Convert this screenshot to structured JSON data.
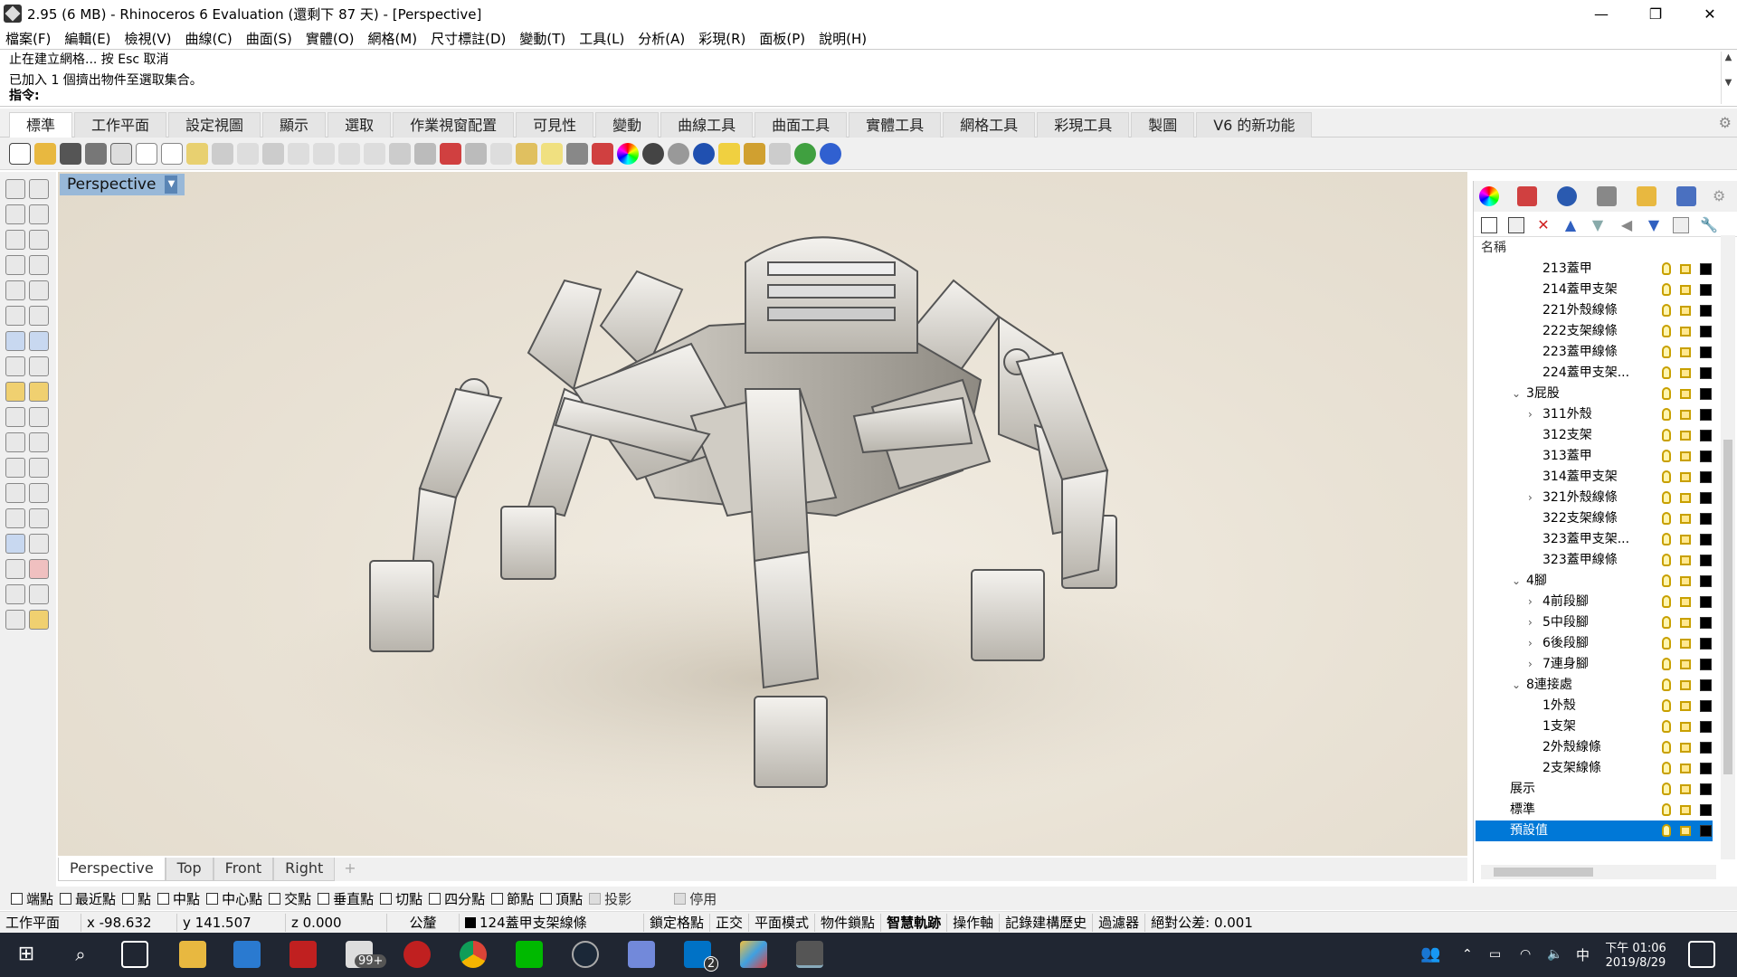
{
  "window": {
    "title": "2.95 (6 MB) - Rhinoceros 6 Evaluation (還剩下 87 天) - [Perspective]",
    "minimize": "—",
    "restore": "❐",
    "close": "✕"
  },
  "menu": [
    "檔案(F)",
    "編輯(E)",
    "檢視(V)",
    "曲線(C)",
    "曲面(S)",
    "實體(O)",
    "網格(M)",
    "尺寸標註(D)",
    "變動(T)",
    "工具(L)",
    "分析(A)",
    "彩現(R)",
    "面板(P)",
    "說明(H)"
  ],
  "command": {
    "history": [
      "止在建立網格... 按 Esc 取消",
      "已加入 1 個擠出物件至選取集合。"
    ],
    "prompt": "指令:"
  },
  "ribbon_tabs": [
    "標準",
    "工作平面",
    "設定視圖",
    "顯示",
    "選取",
    "作業視窗配置",
    "可見性",
    "變動",
    "曲線工具",
    "曲面工具",
    "實體工具",
    "網格工具",
    "彩現工具",
    "製圖",
    "V6 的新功能"
  ],
  "viewport": {
    "title": "Perspective",
    "tabs": [
      "Perspective",
      "Top",
      "Front",
      "Right"
    ],
    "add_tab": "+"
  },
  "layers_panel": {
    "header": "名稱",
    "rows": [
      {
        "name": "213蓋甲",
        "indent": 2,
        "exp": ""
      },
      {
        "name": "214蓋甲支架",
        "indent": 2,
        "exp": ""
      },
      {
        "name": "221外殼線條",
        "indent": 2,
        "exp": ""
      },
      {
        "name": "222支架線條",
        "indent": 2,
        "exp": ""
      },
      {
        "name": "223蓋甲線條",
        "indent": 2,
        "exp": ""
      },
      {
        "name": "224蓋甲支架...",
        "indent": 2,
        "exp": ""
      },
      {
        "name": "3屁股",
        "indent": 1,
        "exp": "v"
      },
      {
        "name": "311外殼",
        "indent": 2,
        "exp": ">"
      },
      {
        "name": "312支架",
        "indent": 2,
        "exp": ""
      },
      {
        "name": "313蓋甲",
        "indent": 2,
        "exp": ""
      },
      {
        "name": "314蓋甲支架",
        "indent": 2,
        "exp": ""
      },
      {
        "name": "321外殼線條",
        "indent": 2,
        "exp": ">"
      },
      {
        "name": "322支架線條",
        "indent": 2,
        "exp": ""
      },
      {
        "name": "323蓋甲支架...",
        "indent": 2,
        "exp": ""
      },
      {
        "name": "323蓋甲線條",
        "indent": 2,
        "exp": ""
      },
      {
        "name": "4腳",
        "indent": 1,
        "exp": "v"
      },
      {
        "name": "4前段腳",
        "indent": 2,
        "exp": ">"
      },
      {
        "name": "5中段腳",
        "indent": 2,
        "exp": ">"
      },
      {
        "name": "6後段腳",
        "indent": 2,
        "exp": ">"
      },
      {
        "name": "7連身腳",
        "indent": 2,
        "exp": ">"
      },
      {
        "name": "8連接處",
        "indent": 1,
        "exp": "v"
      },
      {
        "name": "1外殼",
        "indent": 2,
        "exp": ""
      },
      {
        "name": "1支架",
        "indent": 2,
        "exp": ""
      },
      {
        "name": "2外殼線條",
        "indent": 2,
        "exp": ""
      },
      {
        "name": "2支架線條",
        "indent": 2,
        "exp": ""
      },
      {
        "name": "展示",
        "indent": 0,
        "exp": ""
      },
      {
        "name": "標準",
        "indent": 0,
        "exp": ""
      },
      {
        "name": "預設值",
        "indent": 0,
        "exp": "",
        "selected": true
      }
    ]
  },
  "osnap": [
    {
      "label": "端點",
      "enabled": true
    },
    {
      "label": "最近點",
      "enabled": true
    },
    {
      "label": "點",
      "enabled": true
    },
    {
      "label": "中點",
      "enabled": true
    },
    {
      "label": "中心點",
      "enabled": true
    },
    {
      "label": "交點",
      "enabled": true
    },
    {
      "label": "垂直點",
      "enabled": true
    },
    {
      "label": "切點",
      "enabled": true
    },
    {
      "label": "四分點",
      "enabled": true
    },
    {
      "label": "節點",
      "enabled": true
    },
    {
      "label": "頂點",
      "enabled": true
    },
    {
      "label": "投影",
      "enabled": false
    },
    {
      "label": "停用",
      "enabled": false
    }
  ],
  "status": {
    "cplane": "工作平面",
    "x": "x -98.632",
    "y": "y 141.507",
    "z": "z 0.000",
    "units": "公釐",
    "layer": "124蓋甲支架線條",
    "toggles": [
      "鎖定格點",
      "正交",
      "平面模式",
      "物件鎖點",
      "智慧軌跡",
      "操作軸",
      "記錄建構歷史",
      "過濾器"
    ],
    "bold_toggle": "智慧軌跡",
    "tolerance": "絕對公差: 0.001"
  },
  "taskbar": {
    "time": "下午 01:06",
    "date": "2019/8/29",
    "ime": "中",
    "mail_badge": "99+",
    "outlook_badge": "2"
  },
  "colors": {
    "accent": "#0078d7",
    "viewport_title_bg": "#98b8d8",
    "taskbar_bg": "#202632"
  }
}
